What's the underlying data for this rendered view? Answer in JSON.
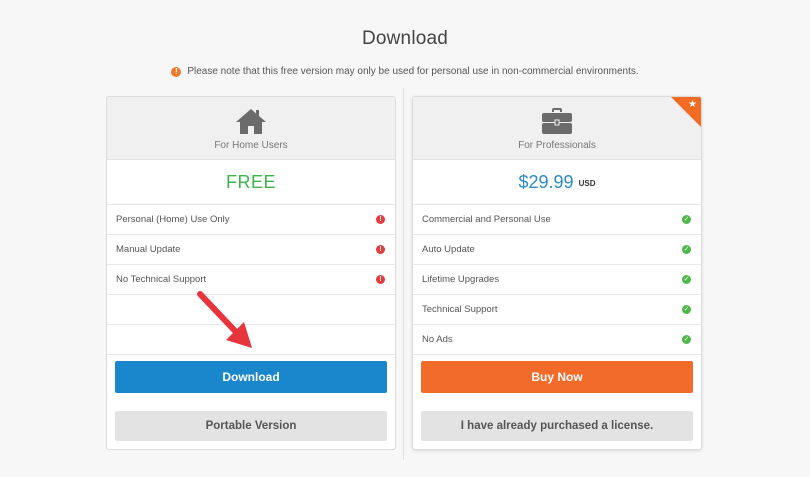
{
  "page": {
    "title": "Download",
    "notice": "Please note that this free version may only be used for personal use in non-commercial environments.",
    "notice_icon": "warning-icon"
  },
  "home_plan": {
    "label": "For Home Users",
    "icon": "home-icon",
    "price": "FREE",
    "features": [
      {
        "label": "Personal (Home) Use Only",
        "status": "not-included"
      },
      {
        "label": "Manual Update",
        "status": "not-included"
      },
      {
        "label": "No Technical Support",
        "status": "not-included"
      }
    ],
    "primary_button": "Download",
    "secondary_button": "Portable Version"
  },
  "pro_plan": {
    "label": "For Professionals",
    "icon": "briefcase-icon",
    "price": "$29.99",
    "currency": "USD",
    "features": [
      {
        "label": "Commercial and Personal Use",
        "status": "included"
      },
      {
        "label": "Auto Update",
        "status": "included"
      },
      {
        "label": "Lifetime Upgrades",
        "status": "included"
      },
      {
        "label": "Technical Support",
        "status": "included"
      },
      {
        "label": "No Ads",
        "status": "included"
      }
    ],
    "primary_button": "Buy Now",
    "secondary_button": "I have already purchased a license."
  },
  "colors": {
    "accent_blue": "#1a86cc",
    "accent_orange": "#f26b2a",
    "free_green": "#3cb44b",
    "price_blue": "#2a8bc8",
    "error_red": "#e23c3c",
    "check_green": "#4cb848",
    "annotation_arrow": "#e8343c"
  }
}
